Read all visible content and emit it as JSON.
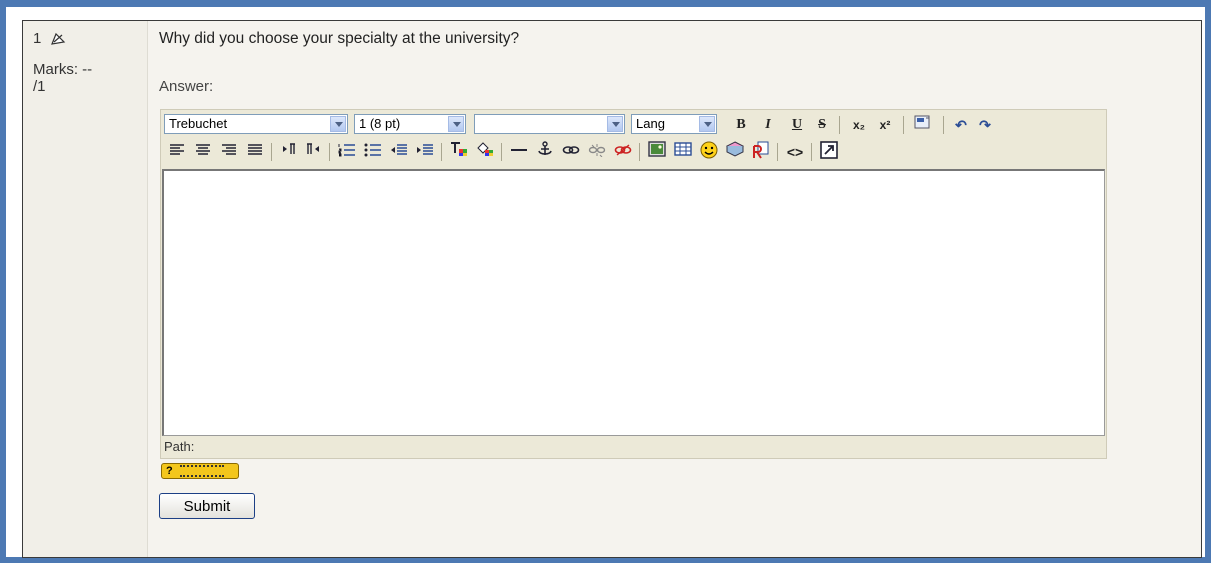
{
  "question": {
    "number": "1",
    "marks_label": "Marks: --",
    "marks_value": "/1",
    "text": "Why did you choose your specialty at the university?",
    "answer_label": "Answer:"
  },
  "editor": {
    "font_select": "Trebuchet",
    "size_select": "1 (8 pt)",
    "format_select": "",
    "lang_select": "Lang",
    "buttons": {
      "bold": "B",
      "italic": "I",
      "underline": "U",
      "strike": "S",
      "subscript": "x₂",
      "superscript": "x²",
      "undo": "↶",
      "redo": "↷",
      "html_source": "<>"
    },
    "path_label": "Path:"
  },
  "help": {
    "icon_text": "?"
  },
  "submit_label": "Submit",
  "colors": {
    "frame": "#4d79b3",
    "panel": "#f5f3ee",
    "toolbar": "#ece9d8"
  }
}
